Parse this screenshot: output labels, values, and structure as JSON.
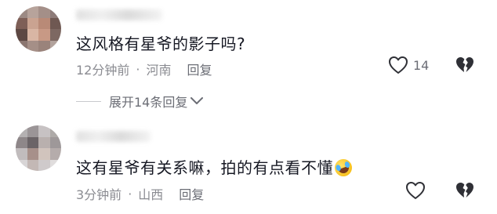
{
  "comments": [
    {
      "text": "这风格有星爷的影子吗?",
      "time": "12分钟前",
      "location": "河南",
      "reply_label": "回复",
      "like_count": "14",
      "replies_toggle": "展开14条回复"
    },
    {
      "text": "这有星爷有关系嘛，拍的有点看不懂",
      "emoji": "rolling-on-floor-laughing-emoji",
      "time": "3分钟前",
      "location": "山西",
      "reply_label": "回复",
      "like_count": ""
    }
  ],
  "separator": "·",
  "colors": {
    "text_primary": "#161823",
    "text_meta": "#8a8b91",
    "icon": "#2f3036"
  },
  "icons": [
    "heart-outline-icon",
    "broken-heart-icon",
    "chevron-down-icon"
  ]
}
